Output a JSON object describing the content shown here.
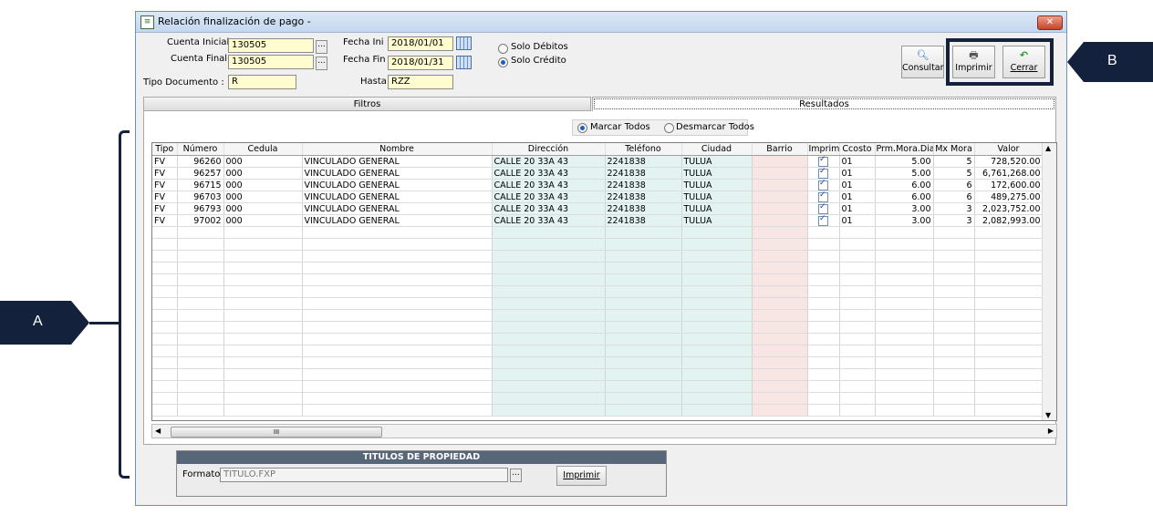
{
  "window": {
    "title": "Relación finalización de pago -"
  },
  "form": {
    "cuenta_inicial_label": "Cuenta Inicial :",
    "cuenta_inicial_value": "130505",
    "cuenta_final_label": "Cuenta Final :",
    "cuenta_final_value": "130505",
    "tipo_documento_label": "Tipo Documento :",
    "tipo_documento_value": "R",
    "fecha_ini_label": "Fecha Ini :",
    "fecha_ini_value": "2018/01/01",
    "fecha_fin_label": "Fecha Fin :",
    "fecha_fin_value": "2018/01/31",
    "hasta_label": "Hasta",
    "hasta_value": "RZZ",
    "solo_debitos": "Solo Débitos",
    "solo_credito": "Solo Crédito",
    "selected_mode": "solo_credito"
  },
  "toolbar": {
    "consultar": "Consultar",
    "imprimir": "Imprimir",
    "cerrar": "Cerrar"
  },
  "tabs": {
    "filtros": "Filtros",
    "resultados": "Resultados",
    "active": "resultados"
  },
  "marcar": {
    "marcar_todos": "Marcar Todos",
    "desmarcar_todos": "Desmarcar Todos",
    "selected": "marcar_todos"
  },
  "table": {
    "columns": [
      "Tipo",
      "Número",
      "Cedula",
      "Nombre",
      "Dirección",
      "Teléfono",
      "Ciudad",
      "Barrio",
      "Imprimir",
      "Ccosto",
      "Prm.Mora.Dias",
      "Mx Mora",
      "Valor"
    ],
    "rows": [
      [
        "FV",
        "96260",
        "000",
        "VINCULADO GENERAL",
        "CALLE 20 33A 43",
        "2241838",
        "TULUA",
        "",
        "✓",
        "01",
        "5.00",
        "5",
        "728,520.00"
      ],
      [
        "FV",
        "96257",
        "000",
        "VINCULADO GENERAL",
        "CALLE 20 33A 43",
        "2241838",
        "TULUA",
        "",
        "✓",
        "01",
        "5.00",
        "5",
        "6,761,268.00"
      ],
      [
        "FV",
        "96715",
        "000",
        "VINCULADO GENERAL",
        "CALLE 20 33A 43",
        "2241838",
        "TULUA",
        "",
        "✓",
        "01",
        "6.00",
        "6",
        "172,600.00"
      ],
      [
        "FV",
        "96703",
        "000",
        "VINCULADO GENERAL",
        "CALLE 20 33A 43",
        "2241838",
        "TULUA",
        "",
        "✓",
        "01",
        "6.00",
        "6",
        "489,275.00"
      ],
      [
        "FV",
        "96793",
        "000",
        "VINCULADO GENERAL",
        "CALLE 20 33A 43",
        "2241838",
        "TULUA",
        "",
        "✓",
        "01",
        "3.00",
        "3",
        "2,023,752.00"
      ],
      [
        "FV",
        "97002",
        "000",
        "VINCULADO GENERAL",
        "CALLE 20 33A 43",
        "2241838",
        "TULUA",
        "",
        "✓",
        "01",
        "3.00",
        "3",
        "2,082,993.00"
      ]
    ],
    "empty_rows": 16,
    "scroll_marker": "III"
  },
  "titulos": {
    "header": "TITULOS DE PROPIEDAD",
    "formato_label": "Formato :",
    "formato_value": "TITULO.FXP",
    "imprimir": "Imprimir"
  },
  "annotations": {
    "a": "A",
    "b": "B",
    "color": "#14213d"
  }
}
